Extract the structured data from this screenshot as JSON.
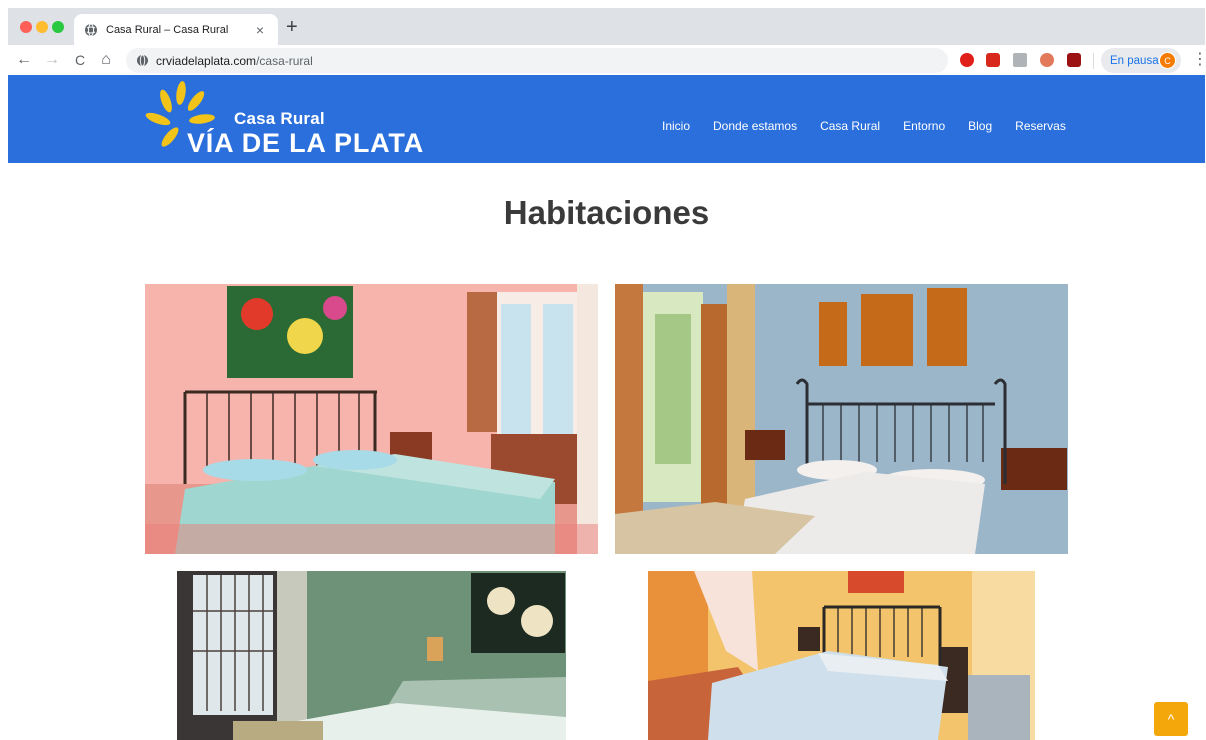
{
  "browser": {
    "tab_title": "Casa Rural – Casa Rural",
    "tab_close": "×",
    "new_tab": "+",
    "url_host": "crviadelaplata.com",
    "url_path": "/casa-rural",
    "pause_label": "En pausa",
    "avatar_initial": "C",
    "nav_back": "←",
    "nav_forward": "→",
    "nav_reload": "C",
    "nav_home": "⌂",
    "menu": "⋮"
  },
  "site": {
    "logo_small": "Casa Rural",
    "logo_big": "VÍA DE LA PLATA",
    "nav": [
      "Inicio",
      "Donde estamos",
      "Casa Rural",
      "Entorno",
      "Blog",
      "Reservas"
    ],
    "brand_color": "#2a6fdb",
    "accent_color": "#f4a70b"
  },
  "main": {
    "heading": "Habitaciones",
    "photos": [
      "bedroom-pink",
      "bedroom-blue",
      "bedroom-green",
      "bedroom-yellow"
    ]
  },
  "scroll_top_icon": "chevron-up-icon",
  "scroll_top_glyph": "^"
}
